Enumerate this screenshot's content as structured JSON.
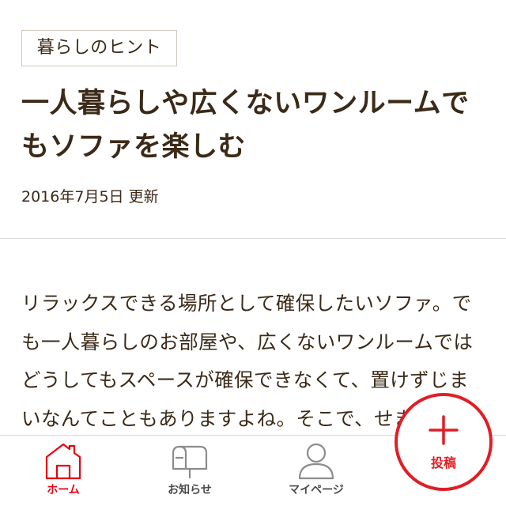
{
  "category_tag": "暮らしのヒント",
  "article": {
    "title": "一人暮らしや広くないワンルームでもソファを楽しむ",
    "date": "2016年7月5日 更新",
    "body": "リラックスできる場所として確保したいソファ。でも一人暮らしのお部屋や、広くないワンルームではどうしてもスペースが確保できなくて、置けずじまいなんてこともありますよね。そこで、せまめのお部屋"
  },
  "bottom_nav": {
    "items": [
      {
        "label": "ホーム",
        "icon": "home-icon",
        "active": true
      },
      {
        "label": "お知らせ",
        "icon": "mailbox-icon",
        "active": false
      },
      {
        "label": "マイページ",
        "icon": "user-icon",
        "active": false
      }
    ],
    "post_button": {
      "label": "投稿",
      "icon": "plus-icon"
    }
  },
  "colors": {
    "accent": "#e60012",
    "text": "#3b2a17",
    "inactive_icon": "#8c8c8c",
    "divider": "#d9d9d9"
  }
}
